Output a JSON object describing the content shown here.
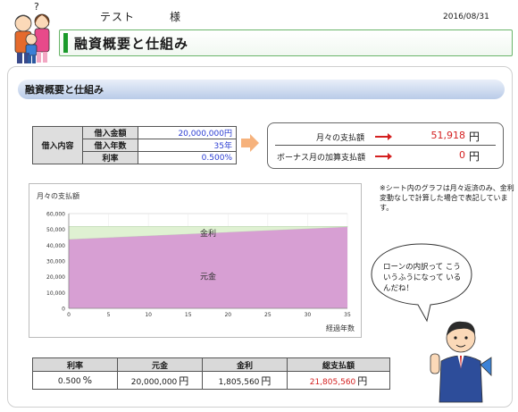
{
  "top": {
    "customer_name": "テスト",
    "honorific": "様",
    "date": "2016/08/31"
  },
  "header": {
    "title": "融資概要と仕組み"
  },
  "section": {
    "title": "融資概要と仕組み"
  },
  "loan": {
    "row_header": "借入内容",
    "rows": [
      {
        "label": "借入金額",
        "value": "20,000,000",
        "unit": "円"
      },
      {
        "label": "借入年数",
        "value": "35",
        "unit": "年"
      },
      {
        "label": "利率",
        "value": "0.500",
        "unit": "%"
      }
    ]
  },
  "results": {
    "monthly_label": "月々の支払額",
    "monthly_value": "51,918",
    "monthly_unit": "円",
    "bonus_label": "ボーナス月の加算支払額",
    "bonus_value": "0",
    "bonus_unit": "円"
  },
  "chart_note": "※シート内のグラフは月々返済のみ、金利変動なしで計算した場合で表記しています。",
  "bubble_text": "ローンの内訳って こういうふうになって いるんだね！",
  "chart_data": {
    "type": "area",
    "title": "月々の支払額",
    "xlabel": "経過年数",
    "ylabel": "",
    "x": [
      0,
      35
    ],
    "xticks": [
      0,
      5,
      10,
      15,
      20,
      25,
      30,
      35
    ],
    "yticks": [
      0,
      10000,
      20000,
      30000,
      40000,
      50000,
      60000
    ],
    "ytick_labels": [
      "0",
      "10,000",
      "20,000",
      "30,000",
      "40,000",
      "50,000",
      "60,000"
    ],
    "ylim": [
      0,
      60000
    ],
    "xlim": [
      0,
      35
    ],
    "series": [
      {
        "name": "元金",
        "values": [
          43600,
          51500
        ],
        "color": "#d79fd3"
      },
      {
        "name": "金利",
        "values": [
          8318,
          418
        ],
        "color": "#dff1d2"
      }
    ],
    "grid": true
  },
  "summary": {
    "headers": [
      "利率",
      "元金",
      "金利",
      "総支払額"
    ],
    "values": [
      {
        "value": "0.500",
        "unit": "%"
      },
      {
        "value": "20,000,000",
        "unit": "円"
      },
      {
        "value": "1,805,560",
        "unit": "円"
      },
      {
        "value": "21,805,560",
        "unit": "円"
      }
    ]
  },
  "colors": {
    "accent_green": "#1a9a2a",
    "section_blue": "#b9cbe8",
    "value_blue": "#2a3cd2",
    "value_red": "#d42020",
    "arrow_orange": "#f6b27c"
  }
}
